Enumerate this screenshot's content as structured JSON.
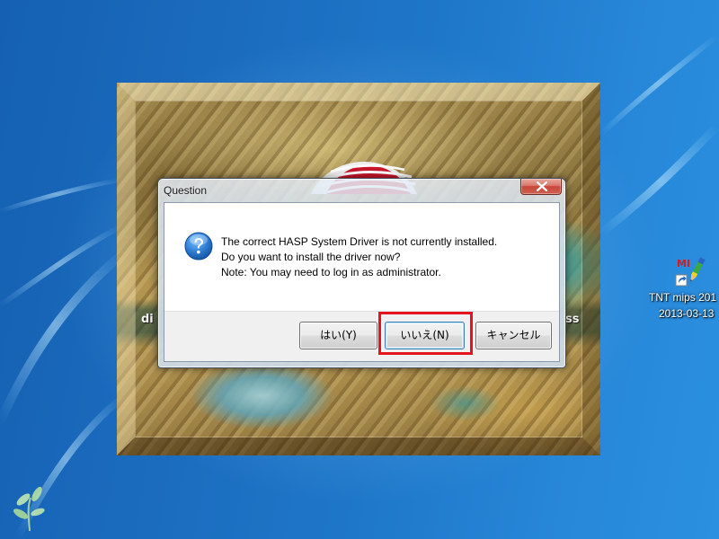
{
  "desktop": {
    "wallpaper_graphic": "leaf-icon",
    "icons": [
      {
        "icon": "tntmips-shortcut-icon",
        "icon_lettering": "MI",
        "label_line1": "TNT mips 201",
        "label_line2": "2013-03-13"
      }
    ]
  },
  "splash": {
    "logo": "splash-logo",
    "caption_fragments": [
      "di",
      "ss"
    ]
  },
  "dialog": {
    "title": "Question",
    "close_icon": "close-icon",
    "icon": "question-icon",
    "message_lines": [
      "The correct HASP System Driver is not currently installed.",
      "Do you want to install the driver now?",
      "Note: You may need to log in as administrator."
    ],
    "buttons": [
      {
        "label": "はい(Y)",
        "focused": false
      },
      {
        "label": "いいえ(N)",
        "focused": true
      },
      {
        "label": "キャンセル",
        "focused": false
      }
    ]
  },
  "annotation": {
    "highlight_color": "#e3141c"
  },
  "colors": {
    "wallpaper_blue": "#1f77c9",
    "dialog_frame": "#d6e1ee",
    "close_button_red": "#c7463a",
    "question_icon_blue": "#2f7fd6",
    "button_bar_gray": "#f0f0f0",
    "default_button_border": "#3c7fb1"
  }
}
